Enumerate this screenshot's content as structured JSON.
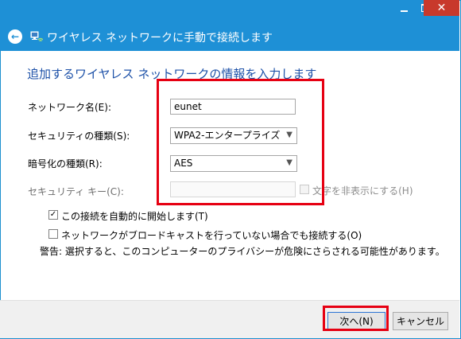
{
  "window": {
    "title": "ワイヤレス ネットワークに手動で接続します",
    "close_glyph": "✕"
  },
  "heading": "追加するワイヤレス ネットワークの情報を入力します",
  "fields": {
    "network_name_label": "ネットワーク名(E):",
    "network_name_value": "eunet",
    "security_type_label": "セキュリティの種類(S):",
    "security_type_value": "WPA2-エンタープライズ",
    "encryption_type_label": "暗号化の種類(R):",
    "encryption_type_value": "AES",
    "security_key_label": "セキュリティ キー(C):",
    "security_key_value": ""
  },
  "options": {
    "hide_chars_label": "文字を非表示にする(H)",
    "auto_connect_label": "この接続を自動的に開始します(T)",
    "auto_connect_checked": true,
    "connect_even_if_not_broadcasting_label": "ネットワークがブロードキャストを行っていない場合でも接続する(O)",
    "connect_even_if_not_broadcasting_checked": false
  },
  "warning": "警告: 選択すると、このコンピューターのプライバシーが危険にさらされる可能性があります。",
  "buttons": {
    "next_label": "次へ(N)",
    "cancel_label": "キャンセル"
  },
  "colors": {
    "titlebar": "#1e90d6",
    "heading": "#1d51a8",
    "highlight": "#e60012"
  },
  "icons": {
    "back": "back-arrow-icon",
    "network": "network-icon",
    "dropdown": "chevron-down-icon"
  }
}
